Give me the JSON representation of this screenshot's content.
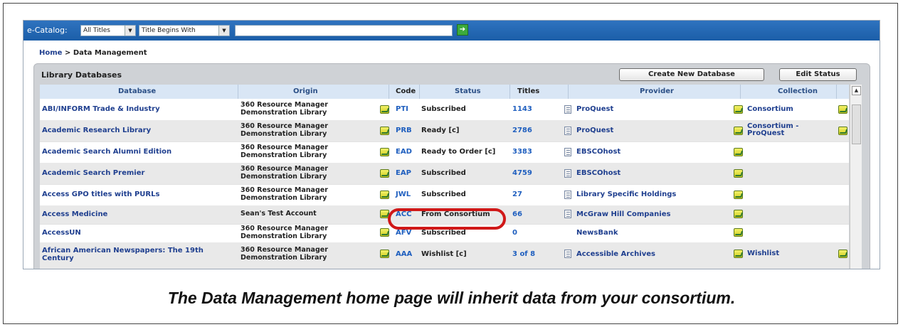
{
  "topbar": {
    "label": "e-Catalog:",
    "select1": "All Titles",
    "select2": "Title Begins With",
    "search_value": ""
  },
  "breadcrumb": {
    "home": "Home",
    "separator": ">",
    "current": "Data Management"
  },
  "panel": {
    "title": "Library Databases",
    "create_button": "Create New Database",
    "edit_button": "Edit Status"
  },
  "columns": [
    "Database",
    "Origin",
    "Code",
    "Status",
    "Titles",
    "Provider",
    "Collection"
  ],
  "rows": [
    {
      "database": "ABI/INFORM Trade & Industry",
      "origin1": "360 Resource Manager",
      "origin2": "Demonstration Library",
      "code": "PTI",
      "status": "Subscribed",
      "titles": "1143",
      "provider": "ProQuest",
      "collection1": "Consortium",
      "collection2": ""
    },
    {
      "database": "Academic Research Library",
      "origin1": "360 Resource Manager",
      "origin2": "Demonstration Library",
      "code": "PRB",
      "status": "Ready [c]",
      "titles": "2786",
      "provider": "ProQuest",
      "collection1": "Consortium -",
      "collection2": "ProQuest"
    },
    {
      "database": "Academic Search Alumni Edition",
      "origin1": "360 Resource Manager",
      "origin2": "Demonstration Library",
      "code": "EAD",
      "status": "Ready to Order [c]",
      "titles": "3383",
      "provider": "EBSCOhost",
      "collection1": "",
      "collection2": ""
    },
    {
      "database": "Academic Search Premier",
      "origin1": "360 Resource Manager",
      "origin2": "Demonstration Library",
      "code": "EAP",
      "status": "Subscribed",
      "titles": "4759",
      "provider": "EBSCOhost",
      "collection1": "",
      "collection2": ""
    },
    {
      "database": "Access GPO titles with PURLs",
      "origin1": "360 Resource Manager",
      "origin2": "Demonstration Library",
      "code": "JWL",
      "status": "Subscribed",
      "titles": "27",
      "provider": "Library Specific Holdings",
      "collection1": "",
      "collection2": ""
    },
    {
      "database": "Access Medicine",
      "origin1": "Sean's Test Account",
      "origin2": "",
      "code": "ACC",
      "status": "From Consortium",
      "titles": "66",
      "provider": "McGraw Hill Companies",
      "collection1": "",
      "collection2": ""
    },
    {
      "database": "AccessUN",
      "origin1": "360 Resource Manager",
      "origin2": "Demonstration Library",
      "code": "AFV",
      "status": "Subscribed",
      "titles": "0",
      "provider": "NewsBank",
      "collection1": "",
      "collection2": ""
    },
    {
      "database": "African American Newspapers: The 19th Century",
      "origin1": "360 Resource Manager",
      "origin2": "Demonstration Library",
      "code": "AAA",
      "status": "Wishlist [c]",
      "titles": "3 of 8",
      "provider": "Accessible Archives",
      "collection1": "Wishlist",
      "collection2": ""
    }
  ],
  "caption": "The Data Management home page will inherit data from your consortium.",
  "colors": {
    "topbar": "#1b5ea8",
    "link": "#1f3f8f",
    "highlight": "#d01818"
  }
}
